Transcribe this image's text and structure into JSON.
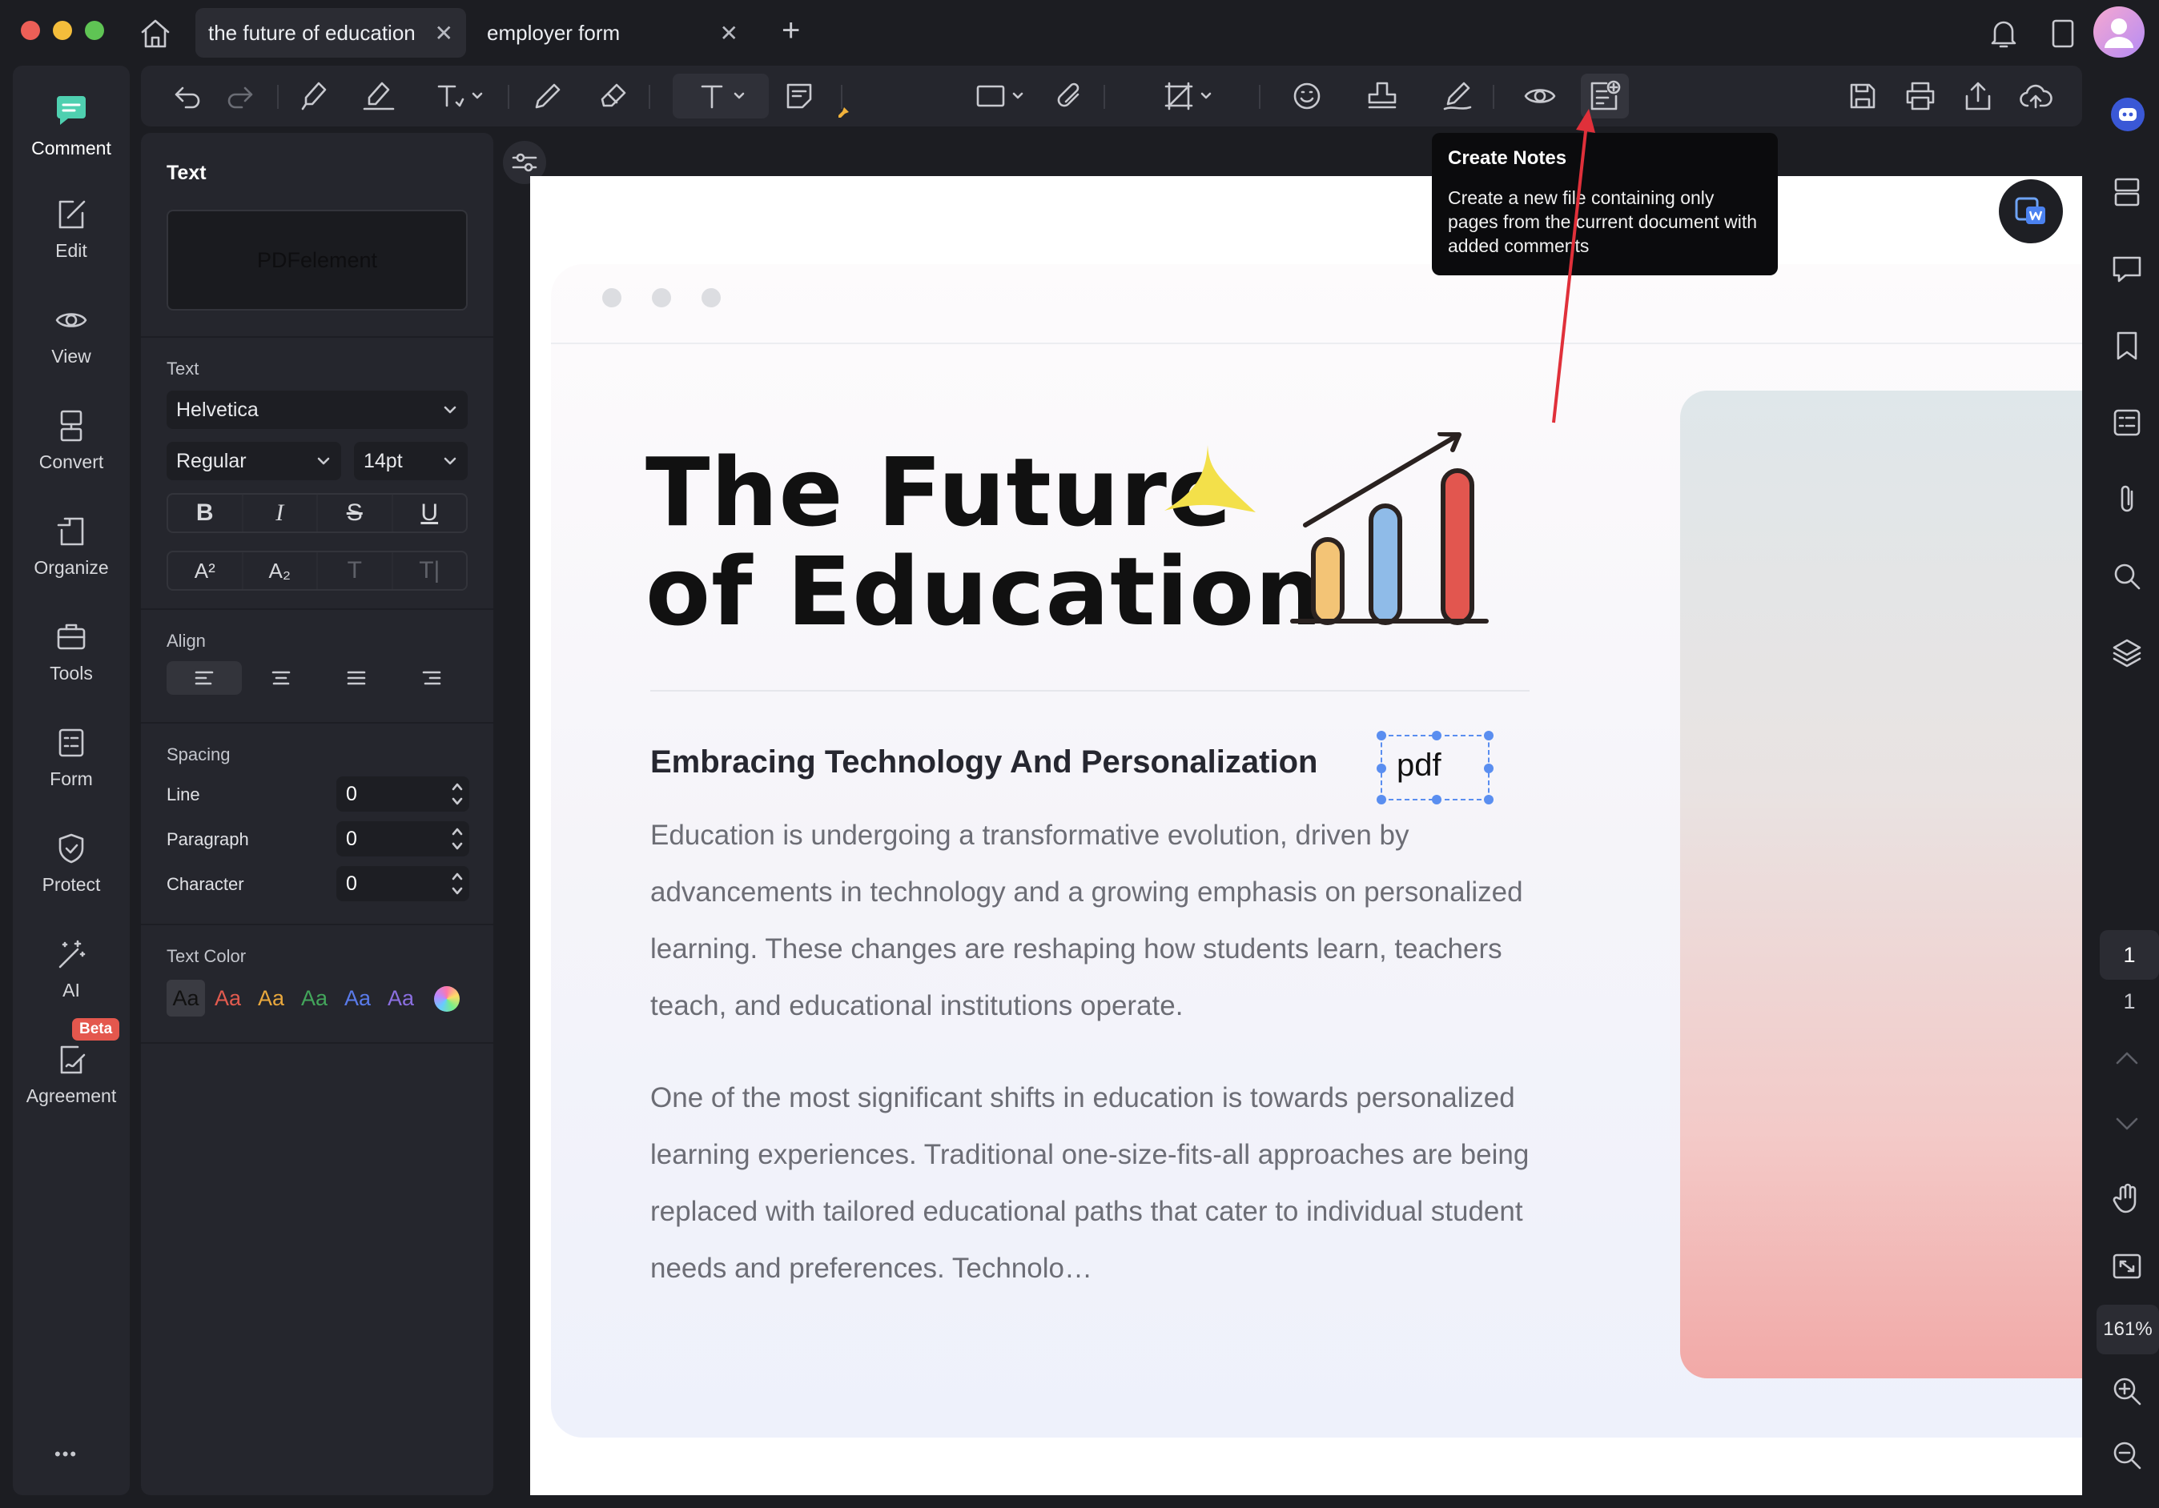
{
  "tabs": [
    {
      "label": "the future of education",
      "active": true
    },
    {
      "label": "employer form",
      "active": false
    }
  ],
  "new_tab_label": "+",
  "close_glyph": "✕",
  "left_nav": [
    {
      "label": "Comment",
      "icon": "comment-icon",
      "active": true
    },
    {
      "label": "Edit",
      "icon": "edit-icon"
    },
    {
      "label": "View",
      "icon": "view-icon"
    },
    {
      "label": "Convert",
      "icon": "convert-icon"
    },
    {
      "label": "Organize",
      "icon": "organize-icon"
    },
    {
      "label": "Tools",
      "icon": "tools-icon"
    },
    {
      "label": "Form",
      "icon": "form-icon"
    },
    {
      "label": "Protect",
      "icon": "protect-icon"
    },
    {
      "label": "AI",
      "icon": "ai-icon"
    },
    {
      "label": "Agreement",
      "icon": "agreement-icon",
      "badge": "Beta"
    }
  ],
  "more_label": "•••",
  "panel": {
    "title": "Text",
    "preview_text": "PDFelement",
    "text_section": "Text",
    "font": "Helvetica",
    "style": "Regular",
    "size": "14pt",
    "format_buttons": [
      "B",
      "I",
      "S",
      "U"
    ],
    "script_buttons": [
      "A²",
      "A₂",
      "T",
      "T|"
    ],
    "align_section": "Align",
    "spacing_section": "Spacing",
    "spacing": {
      "line_label": "Line",
      "line_value": "0",
      "paragraph_label": "Paragraph",
      "paragraph_value": "0",
      "character_label": "Character",
      "character_value": "0"
    },
    "color_section": "Text Color",
    "swatch_label": "Aa",
    "swatch_colors": [
      "#e8e9ec",
      "#e25b4f",
      "#e9a83d",
      "#43a55b",
      "#5a7bea",
      "#8b6fe0"
    ]
  },
  "tooltip": {
    "title": "Create Notes",
    "body": "Create a new file containing only pages from the current document with added comments"
  },
  "document": {
    "title_line1": "The Future",
    "title_line2": "of Education",
    "subheading": "Embracing Technology And Personalization",
    "pdf_label": "pdf",
    "para1": "Education is undergoing a transformative evolution, driven by advancements in technology and a growing emphasis on personalized learning. These changes are reshaping how students learn, teachers teach, and educational institutions operate.",
    "para2": "One of the most significant shifts in education is towards personalized learning experiences. Traditional one-size-fits-all approaches are being replaced with tailored educational paths that cater to individual student needs and preferences. Technolo…"
  },
  "right_rail": {
    "current_page": "1",
    "total_pages": "1",
    "zoom": "161%"
  },
  "colors": {
    "accent_blue": "#5a8ef0",
    "arrow_red": "#e0303a",
    "beta_badge": "#e4574d",
    "comment_green": "#4fd0b0"
  }
}
